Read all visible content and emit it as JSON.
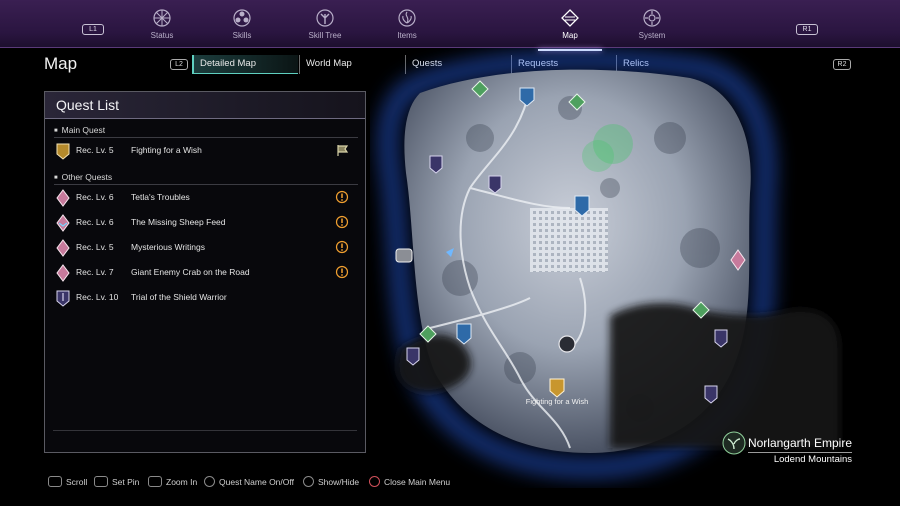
{
  "topnav": {
    "left_shoulder": "L1",
    "right_shoulder": "R1",
    "items": [
      {
        "label": "Status",
        "icon": "status-icon"
      },
      {
        "label": "Skills",
        "icon": "skills-icon"
      },
      {
        "label": "Skill Tree",
        "icon": "skill-tree-icon"
      },
      {
        "label": "Items",
        "icon": "items-icon"
      },
      {
        "label": "Map",
        "icon": "map-icon",
        "active": true
      },
      {
        "label": "System",
        "icon": "system-icon"
      }
    ]
  },
  "page": {
    "title": "Map"
  },
  "tabs": {
    "left_trigger": "L2",
    "right_trigger": "R2",
    "items": [
      {
        "label": "Detailed Map",
        "active": true
      },
      {
        "label": "World Map"
      },
      {
        "label": "Quests"
      },
      {
        "label": "Requests"
      },
      {
        "label": "Relics"
      }
    ]
  },
  "quest_list": {
    "title": "Quest List",
    "main_heading": "Main Quest",
    "main": [
      {
        "level": "Rec. Lv. 5",
        "name": "Fighting for a Wish",
        "icon": "main-quest-icon",
        "status_icon": "flag-icon"
      }
    ],
    "other_heading": "Other Quests",
    "other": [
      {
        "level": "Rec. Lv. 6",
        "name": "Tetla's Troubles",
        "icon": "side-quest-icon",
        "status_icon": "exclamation-icon"
      },
      {
        "level": "Rec. Lv. 6",
        "name": "The Missing Sheep Feed",
        "icon": "side-quest-icon",
        "status_icon": "exclamation-icon"
      },
      {
        "level": "Rec. Lv. 5",
        "name": "Mysterious Writings",
        "icon": "side-quest-icon",
        "status_icon": "exclamation-icon"
      },
      {
        "level": "Rec. Lv. 7",
        "name": "Giant Enemy Crab on the Road",
        "icon": "side-quest-icon",
        "status_icon": "exclamation-icon"
      },
      {
        "level": "Rec. Lv. 10",
        "name": "Trial of the Shield Warrior",
        "icon": "trial-quest-icon"
      }
    ]
  },
  "map": {
    "pin_label": "Fighting for a Wish",
    "region_name": "Norlangarth Empire",
    "area_name": "Lodend Mountains"
  },
  "hints": [
    {
      "label": "Scroll",
      "button": "L3"
    },
    {
      "label": "Set Pin",
      "button": "L3"
    },
    {
      "label": "Zoom In",
      "button": "R3"
    },
    {
      "label": "Quest Name On/Off",
      "button": "square"
    },
    {
      "label": "Show/Hide",
      "button": "triangle"
    },
    {
      "label": "Close Main Menu",
      "button": "circle"
    }
  ],
  "colors": {
    "nav_bg": "#2a1540",
    "tab_accent": "#5fd0c0",
    "quest_warning": "#f2a030",
    "map_border_glow": "#2f6bff"
  }
}
